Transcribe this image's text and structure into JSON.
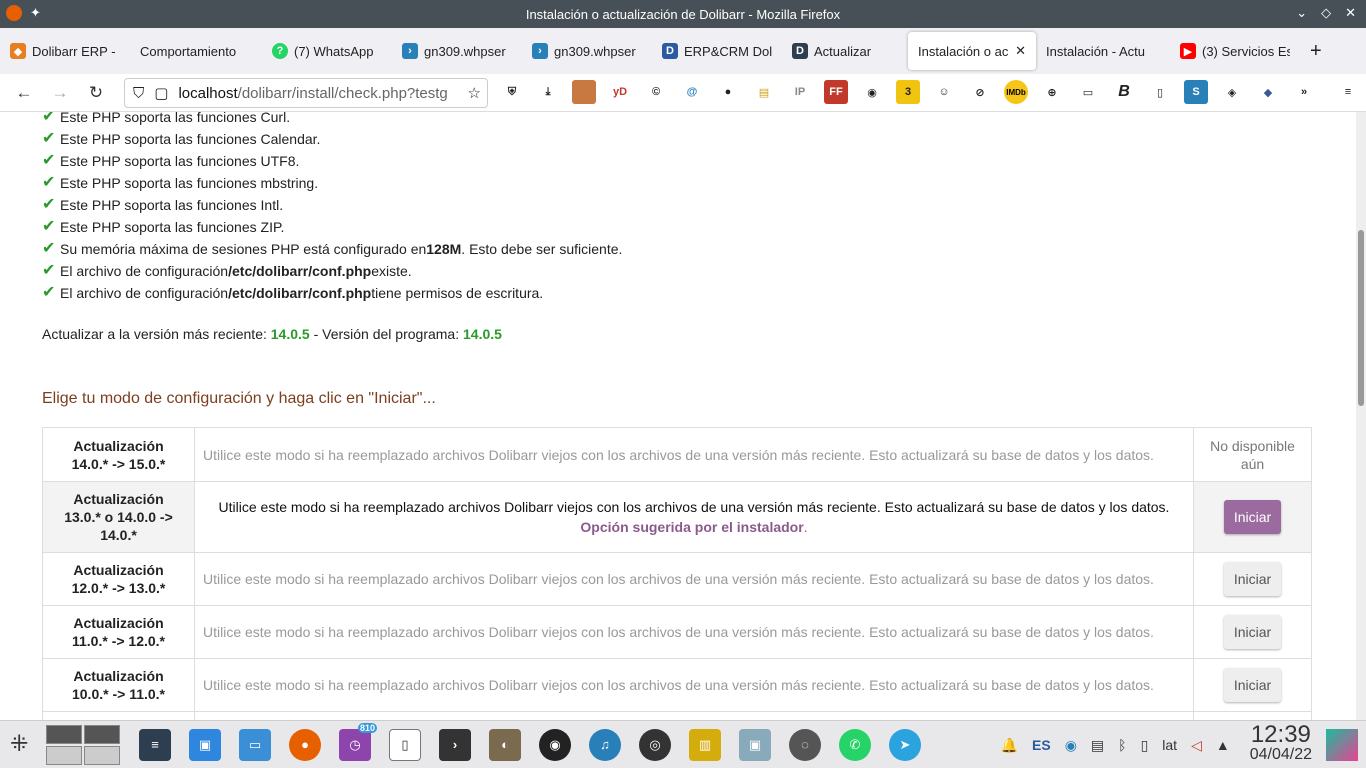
{
  "window": {
    "title": "Instalación o actualización de Dolibarr - Mozilla Firefox"
  },
  "tabs": [
    {
      "label": "Dolibarr ERP -",
      "icon": "dolibarr-icon",
      "color": "#e67e22"
    },
    {
      "label": "Comportamiento",
      "icon": "page-icon",
      "color": "#999999"
    },
    {
      "label": "(7) WhatsApp",
      "icon": "whatsapp-icon",
      "color": "#25d366"
    },
    {
      "label": "gn309.whpser",
      "icon": "server-icon",
      "color": "#2980b9"
    },
    {
      "label": "gn309.whpser",
      "icon": "server-icon",
      "color": "#2980b9"
    },
    {
      "label": "ERP&CRM Dol",
      "icon": "dolibarr-d-icon",
      "color": "#2c5aa0"
    },
    {
      "label": "Actualizar",
      "icon": "dolibarr-d-icon",
      "color": "#2c3e50"
    },
    {
      "label": "Instalación o ac",
      "icon": "",
      "color": "",
      "active": true
    },
    {
      "label": "Instalación - Actu",
      "icon": "",
      "color": ""
    },
    {
      "label": "(3) Servicios Es",
      "icon": "youtube-icon",
      "color": "#ff0000"
    }
  ],
  "url": {
    "host": "localhost",
    "path": "/dolibarr/install/check.php?testg"
  },
  "checks": [
    {
      "text": "Este PHP soporta las funciones Curl."
    },
    {
      "text": "Este PHP soporta las funciones Calendar."
    },
    {
      "text": "Este PHP soporta las funciones UTF8."
    },
    {
      "text": "Este PHP soporta las funciones mbstring."
    },
    {
      "text": "Este PHP soporta las funciones Intl."
    },
    {
      "text": "Este PHP soporta las funciones ZIP."
    },
    {
      "pre": "Su memória máxima de sesiones PHP está configurado en ",
      "bold": "128M",
      "post": ". Esto debe ser suficiente."
    },
    {
      "pre": "El archivo de configuración ",
      "bold": "/etc/dolibarr/conf.php",
      "post": " existe."
    },
    {
      "pre": "El archivo de configuración ",
      "bold": "/etc/dolibarr/conf.php",
      "post": " tiene permisos de escritura."
    }
  ],
  "version": {
    "label1": "Actualizar a la versión más reciente: ",
    "latest": "14.0.5",
    "sep": " - Versión del programa: ",
    "program": "14.0.5"
  },
  "choose_mode": "Elige tu modo de configuración y haga clic en \"Iniciar\"...",
  "modes": [
    {
      "line1": "Actualización",
      "line2": "14.0.* -> 15.0.*",
      "desc": "Utilice este modo si ha reemplazado archivos Dolibarr viejos con los archivos de una versión más reciente. Esto actualizará su base de datos y los datos.",
      "action": "No disponible aún",
      "status": "unavailable"
    },
    {
      "line1": "Actualización",
      "line2": "13.0.* o 14.0.0 ->",
      "line3": "14.0.*",
      "desc": "Utilice este modo si ha reemplazado archivos Dolibarr viejos con los archivos de una versión más reciente. Esto actualizará su base de datos y los datos.",
      "suggest": "Opción sugerida por el instalador",
      "suggest_end": ".",
      "action": "Iniciar",
      "status": "suggested"
    },
    {
      "line1": "Actualización",
      "line2": "12.0.* -> 13.0.*",
      "desc": "Utilice este modo si ha reemplazado archivos Dolibarr viejos con los archivos de una versión más reciente. Esto actualizará su base de datos y los datos.",
      "action": "Iniciar",
      "status": "available"
    },
    {
      "line1": "Actualización",
      "line2": "11.0.* -> 12.0.*",
      "desc": "Utilice este modo si ha reemplazado archivos Dolibarr viejos con los archivos de una versión más reciente. Esto actualizará su base de datos y los datos.",
      "action": "Iniciar",
      "status": "available"
    },
    {
      "line1": "Actualización",
      "line2": "10.0.* -> 11.0.*",
      "desc": "Utilice este modo si ha reemplazado archivos Dolibarr viejos con los archivos de una versión más reciente. Esto actualizará su base de datos y los datos.",
      "action": "Iniciar",
      "status": "available"
    }
  ],
  "taskbar": {
    "lang": "ES",
    "keyboard": "lat",
    "time": "12:39",
    "date": "04/04/22",
    "badge": "810"
  }
}
